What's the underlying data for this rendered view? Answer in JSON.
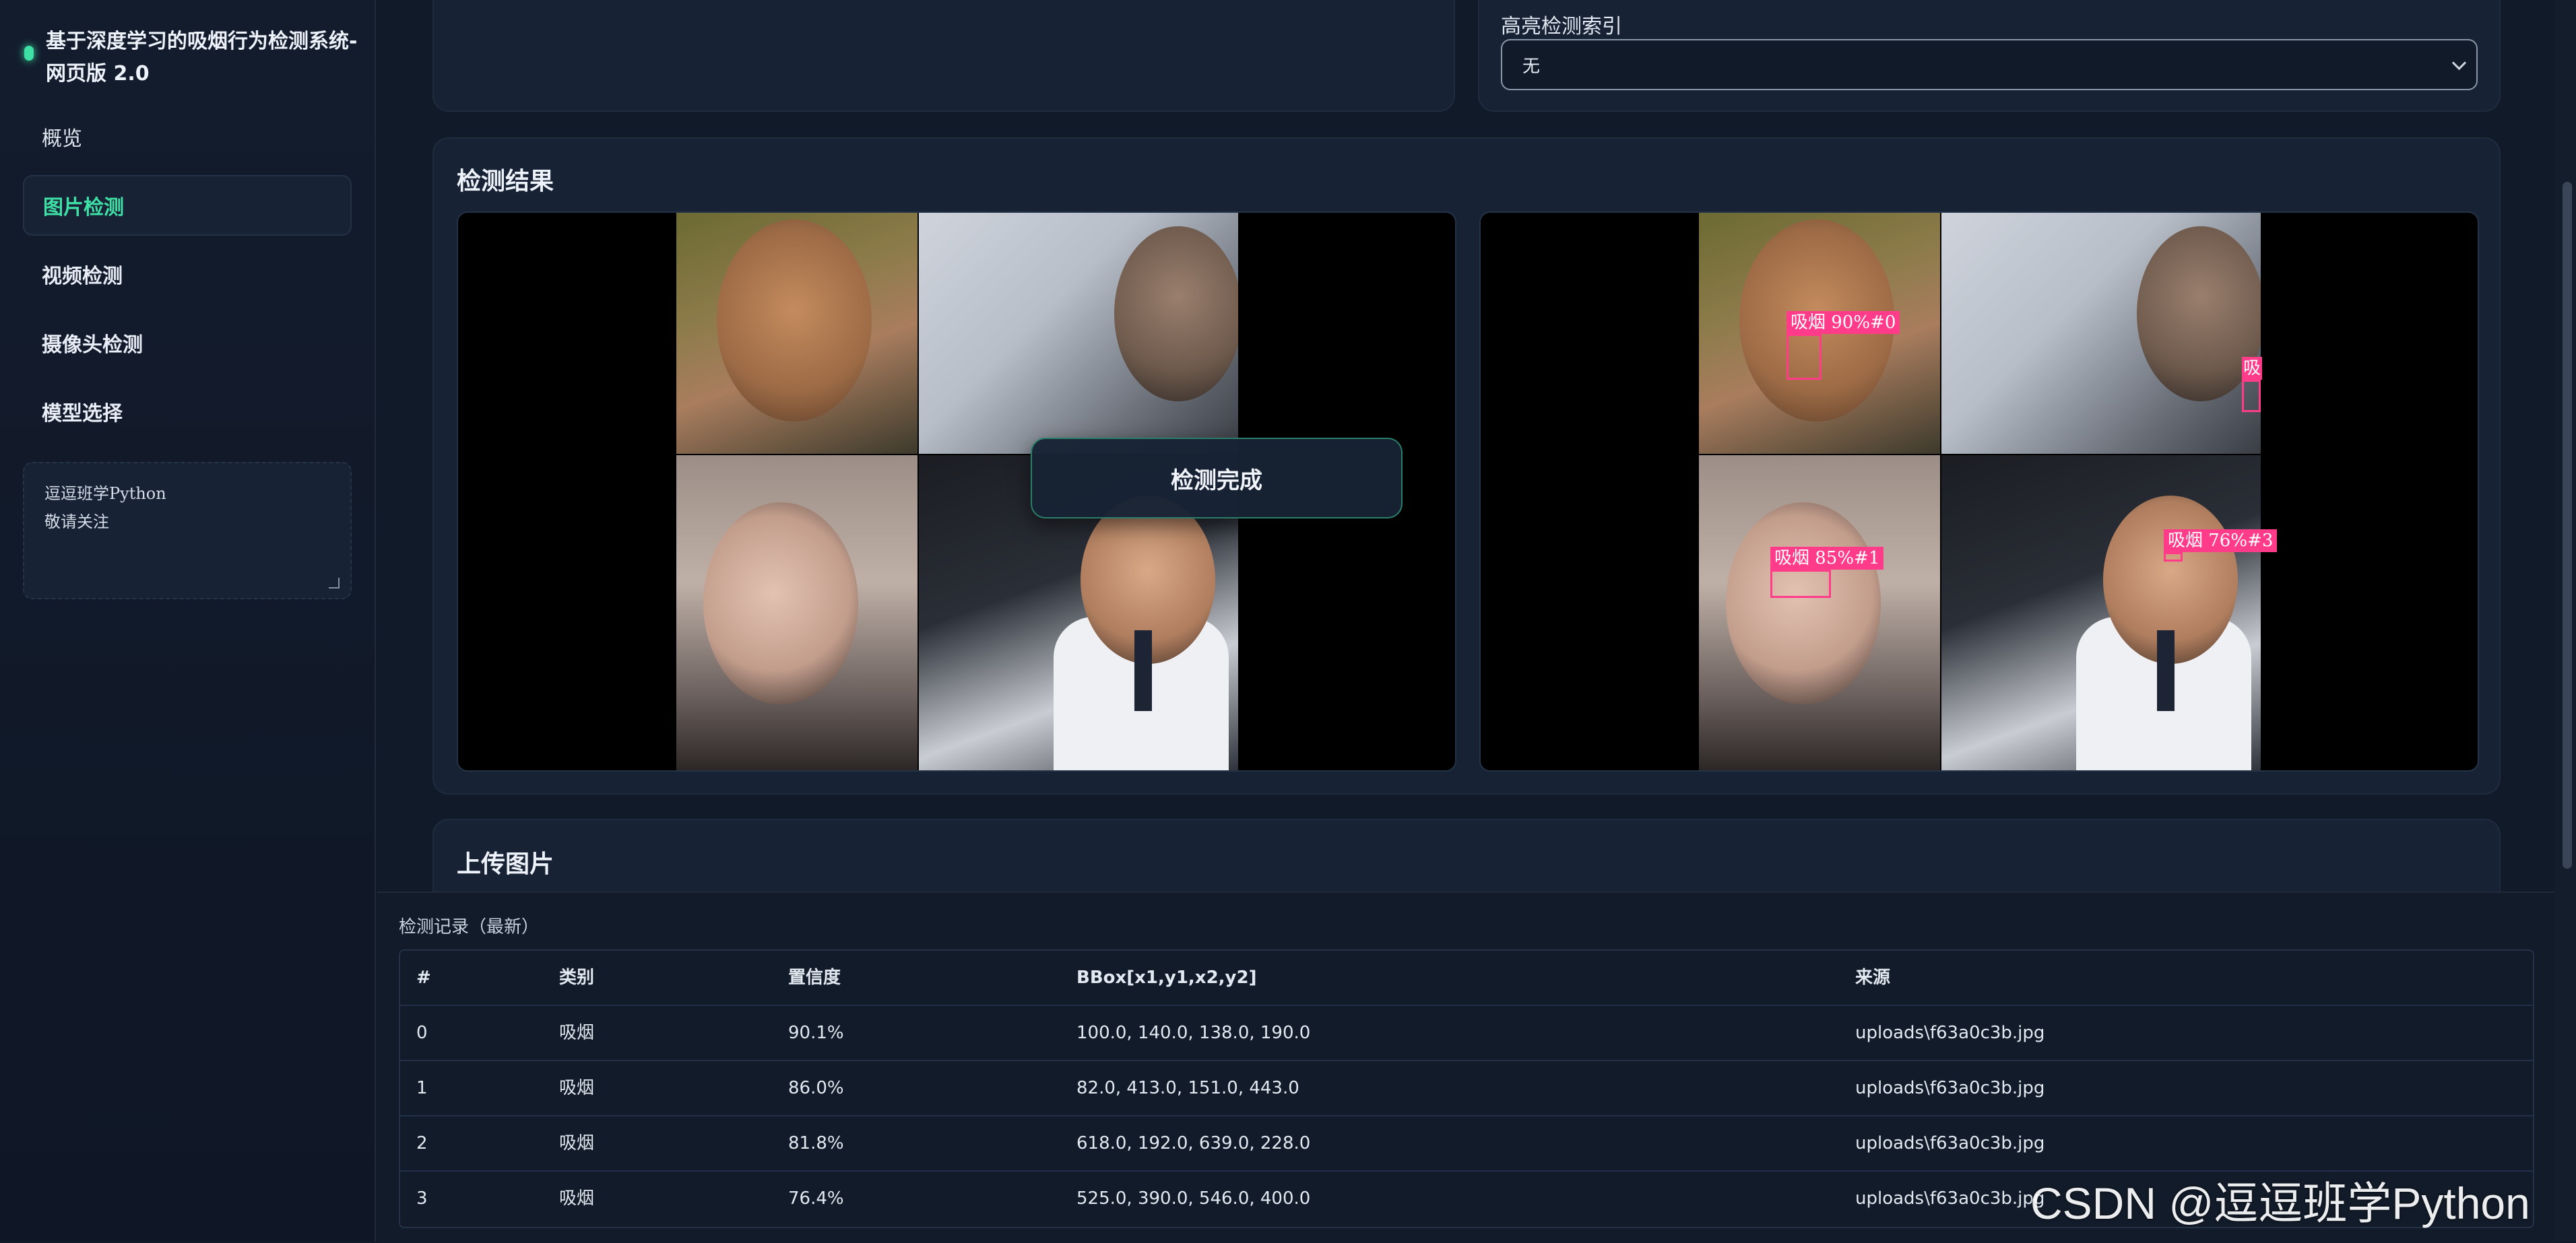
{
  "app": {
    "title": "基于深度学习的吸烟行为检测系统-网页版 2.0"
  },
  "sidebar": {
    "items": [
      {
        "label": "概览"
      },
      {
        "label": "图片检测",
        "active": true
      },
      {
        "label": "视频检测"
      },
      {
        "label": "摄像头检测"
      },
      {
        "label": "模型选择"
      }
    ],
    "note": {
      "line1": "逗逗班学Python",
      "line2": "敬请关注"
    }
  },
  "controls": {
    "highlight_label": "高亮检测索引",
    "highlight_value": "无"
  },
  "results": {
    "title": "检测结果",
    "toast": "检测完成",
    "detections": [
      {
        "label": "吸烟 90%#0"
      },
      {
        "label": "吸烟 85%#1"
      },
      {
        "label": "吸烟 76%#3"
      },
      {
        "label": "吸"
      }
    ]
  },
  "upload": {
    "title": "上传图片"
  },
  "records": {
    "title": "检测记录（最新）",
    "columns": [
      "#",
      "类别",
      "置信度",
      "BBox[x1,y1,x2,y2]",
      "来源"
    ],
    "rows": [
      [
        "0",
        "吸烟",
        "90.1%",
        "100.0, 140.0, 138.0, 190.0",
        "uploads\\f63a0c3b.jpg"
      ],
      [
        "1",
        "吸烟",
        "86.0%",
        "82.0, 413.0, 151.0, 443.0",
        "uploads\\f63a0c3b.jpg"
      ],
      [
        "2",
        "吸烟",
        "81.8%",
        "618.0, 192.0, 639.0, 228.0",
        "uploads\\f63a0c3b.jpg"
      ],
      [
        "3",
        "吸烟",
        "76.4%",
        "525.0, 390.0, 546.0, 400.0",
        "uploads\\f63a0c3b.jpg"
      ]
    ]
  },
  "watermark": "CSDN @逗逗班学Python",
  "colors": {
    "accent": "#3ee0a6",
    "detection": "#ff3b8a",
    "background": "#111a28"
  }
}
